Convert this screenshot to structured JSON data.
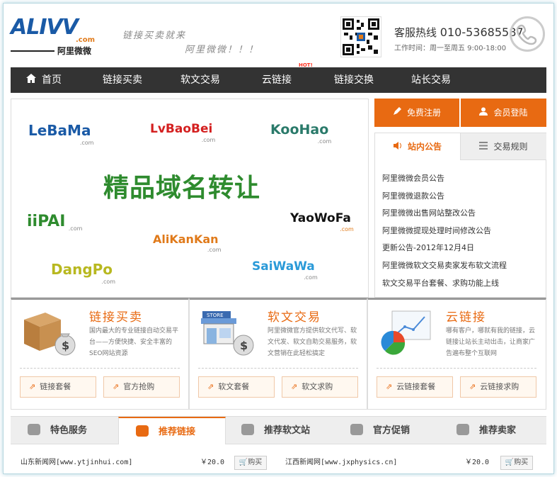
{
  "header": {
    "logo_text": "ALIVV",
    "logo_com": ".com",
    "logo_cn": "阿里微微",
    "slogan_line1": "链接买卖就来",
    "slogan_line2": "阿里微微！！！",
    "hotline_label": "客服热线",
    "hotline_number": "010-53685587",
    "work_time": "工作时间：周一至周五  9:00-18:00"
  },
  "nav": {
    "items": [
      {
        "label": "首页",
        "icon": "home-icon"
      },
      {
        "label": "链接买卖"
      },
      {
        "label": "软文交易"
      },
      {
        "label": "云链接",
        "badge": "HOT!"
      },
      {
        "label": "链接交换"
      },
      {
        "label": "站长交易"
      }
    ]
  },
  "banner": {
    "title": "精品域名转让",
    "domains": [
      {
        "name": "LeBaMa",
        "tld": ".com",
        "color": "#1a5aa6"
      },
      {
        "name": "LvBaoBei",
        "tld": ".com",
        "color": "#d42020"
      },
      {
        "name": "KooHao",
        "tld": ".com",
        "color": "#2a7a6a"
      },
      {
        "name": "iiPAI",
        "tld": ".com",
        "color": "#2e8b2e"
      },
      {
        "name": "AliKanKan",
        "tld": ".com",
        "color": "#e07a1a"
      },
      {
        "name": "YaoWoFa",
        "tld": ".com",
        "color": "#111111"
      },
      {
        "name": "DangPo",
        "tld": ".com",
        "color": "#b8b820"
      },
      {
        "name": "SaiWaWa",
        "tld": ".com",
        "color": "#2a9ad8"
      }
    ]
  },
  "account": {
    "register_label": "免费注册",
    "login_label": "会员登陆"
  },
  "notice": {
    "tab_active": "站内公告",
    "tab_other": "交易规则",
    "items": [
      "阿里微微会员公告",
      "阿里微微退款公告",
      "阿里微微出售网站整改公告",
      "阿里微微提现处理时间修改公告",
      "更新公告-2012年12月4日",
      "阿里微微软文交易卖家发布软文流程",
      "软文交易平台套餐、求购功能上线"
    ]
  },
  "sections": [
    {
      "title": "链接买卖",
      "desc": "国内最大的专业链接自动交易平台——方便快捷、安全丰富的SEO网站资源",
      "buttons": [
        "链接套餐",
        "官方抢购"
      ]
    },
    {
      "title": "软文交易",
      "desc": "阿里微微官方提供软文代写、软文代发、软文自助交易服务，软文营销在此轻松搞定",
      "buttons": [
        "软文套餐",
        "软文求购"
      ]
    },
    {
      "title": "云链接",
      "desc": "哪有客户，哪就有我的链接，云链接让站长主动出击，让商家广告遍布整个互联网",
      "buttons": [
        "云链接套餐",
        "云链接求购"
      ]
    }
  ],
  "bottom_tabs": [
    "特色服务",
    "推荐链接",
    "推荐软文站",
    "官方促销",
    "推荐卖家"
  ],
  "listings": [
    {
      "site": "山东新闻网[www.ytjinhui.com]",
      "price": "￥20.0",
      "action": "购买"
    },
    {
      "site": "江西新闻网[www.jxphysics.cn]",
      "price": "￥20.0",
      "action": "购买"
    }
  ]
}
